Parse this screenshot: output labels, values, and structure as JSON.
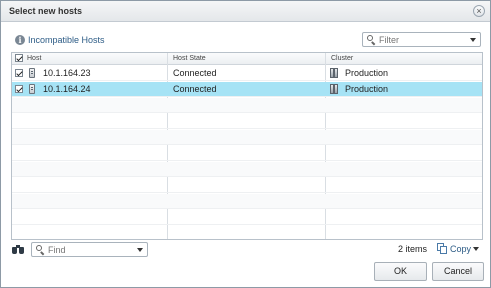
{
  "dialog": {
    "title": "Select new hosts",
    "close_glyph": "×"
  },
  "toolbar": {
    "incompatible_label": "Incompatible Hosts",
    "filter_placeholder": "Filter"
  },
  "grid": {
    "columns": [
      "Host",
      "Host State",
      "Cluster"
    ],
    "rows": [
      {
        "checked": true,
        "host": "10.1.164.23",
        "state": "Connected",
        "cluster": "Production",
        "selected": false
      },
      {
        "checked": true,
        "host": "10.1.164.24",
        "state": "Connected",
        "cluster": "Production",
        "selected": true
      }
    ],
    "header_checked": true
  },
  "footer": {
    "find_placeholder": "Find",
    "items_count": "2 items",
    "copy_label": "Copy"
  },
  "buttons": {
    "ok": "OK",
    "cancel": "Cancel"
  },
  "colors": {
    "selection": "#a6e3f5",
    "link_text": "#2d5c86"
  },
  "icons": {
    "info": "info-icon",
    "search": "search-icon",
    "host": "host-server-icon",
    "cluster": "cluster-icon",
    "find": "binoculars-icon",
    "copy": "copy-icon"
  }
}
